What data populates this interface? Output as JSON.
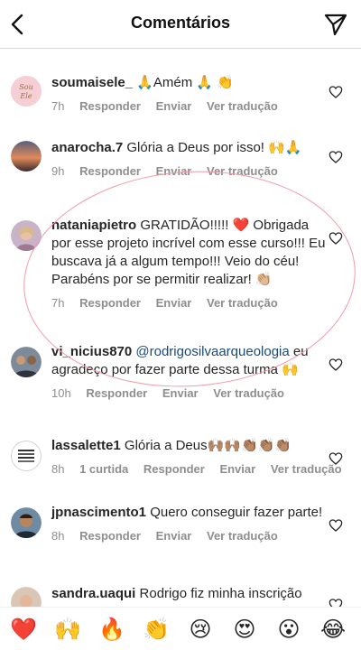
{
  "header": {
    "title": "Comentários"
  },
  "comments": [
    {
      "username": "soumaisele_",
      "text": " 🙏Amém 🙏 👏",
      "time": "7h",
      "reply": "Responder",
      "send": "Enviar",
      "translate": "Ver tradução",
      "avatar_text": "Sou Ele"
    },
    {
      "username": "anarocha.7",
      "text": " Glória a Deus por isso! 🙌🙏",
      "time": "9h",
      "reply": "Responder",
      "send": "Enviar",
      "translate": "Ver tradução"
    },
    {
      "username": "nataniapietro",
      "text": " GRATIDÃO!!!!! ❤️ Obrigada por esse projeto incrível com esse curso!!! Eu buscava já a algum tempo!!! Veio do céu! Parabéns por se permitir realizar! 👏🏼",
      "time": "7h",
      "reply": "Responder",
      "send": "Enviar",
      "translate": "Ver tradução"
    },
    {
      "username": "vi_nicius870",
      "mention": " @rodrigosilvaarqueologia",
      "text": " eu agradeço por fazer parte dessa turma 🙌",
      "time": "10h",
      "reply": "Responder",
      "send": "Enviar",
      "translate": "Ver tradução"
    },
    {
      "username": "lassalette1",
      "text": " Glória a Deus🙌🏽🙌🏽👏🏽👏🏽👏🏽",
      "time": "8h",
      "likes": "1 curtida",
      "reply": "Responder",
      "send": "Enviar",
      "translate": "Ver tradução"
    },
    {
      "username": "jpnascimento1",
      "text": " Quero conseguir fazer parte!",
      "time": "8h",
      "reply": "Responder",
      "send": "Enviar",
      "translate": "Ver tradução"
    },
    {
      "username": "sandra.uaqui",
      "text": " Rodrigo fiz minha inscrição"
    }
  ],
  "reactions": [
    "❤️",
    "🙌",
    "🔥",
    "👏",
    "😢",
    "😍",
    "😮",
    "😂"
  ],
  "colors": {
    "overlay_circle": "#f19aa9",
    "meta_text": "#8e8e8e",
    "mention": "#1a4a7a"
  }
}
